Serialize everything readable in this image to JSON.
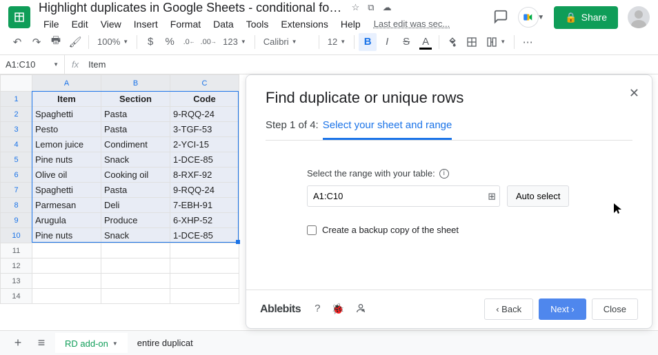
{
  "doc": {
    "title": "Highlight duplicates in Google Sheets - conditional form...",
    "last_edit": "Last edit was sec..."
  },
  "title_icons": {
    "star": "☆",
    "move": "⧉",
    "cloud": "☁"
  },
  "menu": [
    "File",
    "Edit",
    "View",
    "Insert",
    "Format",
    "Data",
    "Tools",
    "Extensions",
    "Help"
  ],
  "toolbar": {
    "zoom": "100%",
    "currency": "$",
    "percent": "%",
    "dec_dec": ".0",
    "dec_inc": ".00",
    "num_fmt": "123",
    "font": "Calibri",
    "font_size": "12",
    "more": "⋯"
  },
  "namebox": "A1:C10",
  "formula_value": "Item",
  "columns": [
    "A",
    "B",
    "C"
  ],
  "rows": [
    {
      "n": "1",
      "cells": [
        "Item",
        "Section",
        "Code"
      ],
      "header": true
    },
    {
      "n": "2",
      "cells": [
        "Spaghetti",
        "Pasta",
        "9-RQQ-24"
      ]
    },
    {
      "n": "3",
      "cells": [
        "Pesto",
        "Pasta",
        "3-TGF-53"
      ]
    },
    {
      "n": "4",
      "cells": [
        "Lemon juice",
        "Condiment",
        "2-YCI-15"
      ]
    },
    {
      "n": "5",
      "cells": [
        "Pine nuts",
        "Snack",
        "1-DCE-85"
      ]
    },
    {
      "n": "6",
      "cells": [
        "Olive oil",
        "Cooking oil",
        "8-RXF-92"
      ]
    },
    {
      "n": "7",
      "cells": [
        "Spaghetti",
        "Pasta",
        "9-RQQ-24"
      ]
    },
    {
      "n": "8",
      "cells": [
        "Parmesan",
        "Deli",
        "7-EBH-91"
      ]
    },
    {
      "n": "9",
      "cells": [
        "Arugula",
        "Produce",
        "6-XHP-52"
      ]
    },
    {
      "n": "10",
      "cells": [
        "Pine nuts",
        "Snack",
        "1-DCE-85"
      ]
    },
    {
      "n": "11",
      "cells": [
        "",
        "",
        ""
      ],
      "empty": true
    },
    {
      "n": "12",
      "cells": [
        "",
        "",
        ""
      ],
      "empty": true
    },
    {
      "n": "13",
      "cells": [
        "",
        "",
        ""
      ],
      "empty": true
    },
    {
      "n": "14",
      "cells": [
        "",
        "",
        ""
      ],
      "empty": true
    }
  ],
  "tabs": [
    {
      "label": "RD add-on",
      "active": true
    },
    {
      "label": "entire duplicat",
      "active": false
    }
  ],
  "panel": {
    "title": "Find duplicate or unique rows",
    "step_prefix": "Step 1 of 4:",
    "step_link": "Select your sheet and range",
    "range_label": "Select the range with your table:",
    "range_value": "A1:C10",
    "autoselect": "Auto select",
    "backup_label": "Create a backup copy of the sheet",
    "brand": "Ablebits",
    "back": "‹ Back",
    "next": "Next ›",
    "close": "Close"
  },
  "share": {
    "label": "Share",
    "lock": "🔒"
  }
}
